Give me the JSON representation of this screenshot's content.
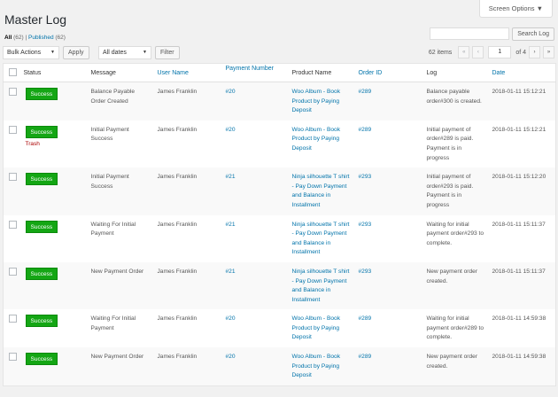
{
  "screen_options": "Screen Options ▼",
  "title": "Master Log",
  "filters": {
    "all": "All",
    "all_count": "(62)",
    "sep": "|",
    "published": "Published",
    "published_count": "(62)"
  },
  "search": {
    "button": "Search Log"
  },
  "tablenav": {
    "bulk": "Bulk Actions",
    "apply": "Apply",
    "dates": "All dates",
    "filter": "Filter",
    "items": "62 items",
    "first": "«",
    "prev": "‹",
    "page": "1",
    "of": "of 4",
    "next": "›",
    "last": "»"
  },
  "columns": [
    "Status",
    "Message",
    "User Name",
    "Payment Number",
    "Product Name",
    "Order ID",
    "Log",
    "Date"
  ],
  "rows": [
    {
      "status": "Success",
      "message": "Balance Payable Order Created",
      "user": "James Franklin",
      "payment": "#20",
      "product": "Woo Album - Book Product by Paying Deposit",
      "order": "#289",
      "log": "Balance payable order#300 is created.",
      "date": "2018-01-11 15:12:21"
    },
    {
      "status": "Success",
      "trash": "Trash",
      "message": "Initial Payment Success",
      "user": "James Franklin",
      "payment": "#20",
      "product": "Woo Album - Book Product by Paying Deposit",
      "order": "#289",
      "log": "Initial payment of order#289 is paid. Payment is in progress",
      "date": "2018-01-11 15:12:21"
    },
    {
      "status": "Success",
      "message": "Initial Payment Success",
      "user": "James Franklin",
      "payment": "#21",
      "product": "Ninja silhouette T shirt - Pay Down Payment and Balance in Installment",
      "order": "#293",
      "log": "Initial payment of order#293 is paid. Payment is in progress",
      "date": "2018-01-11 15:12:20"
    },
    {
      "status": "Success",
      "message": "Waiting For Initial Payment",
      "user": "James Franklin",
      "payment": "#21",
      "product": "Ninja silhouette T shirt - Pay Down Payment and Balance in Installment",
      "order": "#293",
      "log": "Waiting for initial payment order#293 to complete.",
      "date": "2018-01-11 15:11:37"
    },
    {
      "status": "Success",
      "message": "New Payment Order",
      "user": "James Franklin",
      "payment": "#21",
      "product": "Ninja silhouette T shirt - Pay Down Payment and Balance in Installment",
      "order": "#293",
      "log": "New payment order created.",
      "date": "2018-01-11 15:11:37"
    },
    {
      "status": "Success",
      "message": "Waiting For Initial Payment",
      "user": "James Franklin",
      "payment": "#20",
      "product": "Woo Album - Book Product by Paying Deposit",
      "order": "#289",
      "log": "Waiting for initial payment order#289 to complete.",
      "date": "2018-01-11 14:59:38"
    },
    {
      "status": "Success",
      "message": "New Payment Order",
      "user": "James Franklin",
      "payment": "#20",
      "product": "Woo Album - Book Product by Paying Deposit",
      "order": "#289",
      "log": "New payment order created.",
      "date": "2018-01-11 14:59:38"
    }
  ]
}
